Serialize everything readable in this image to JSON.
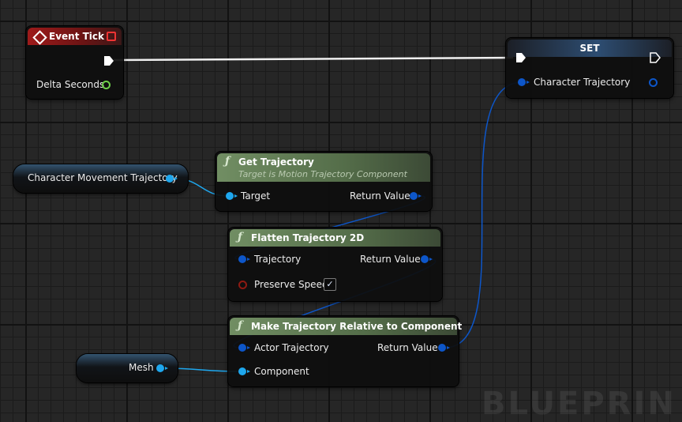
{
  "watermark": "BLUEPRIN",
  "event_tick": {
    "title": "Event Tick",
    "delta_seconds": "Delta Seconds"
  },
  "set_node": {
    "title": "SET",
    "pin": "Character Trajectory"
  },
  "char_move_var": {
    "label": "Character Movement Trajectory"
  },
  "get_trajectory": {
    "title": "Get Trajectory",
    "subtitle": "Target is Motion Trajectory Component",
    "target": "Target",
    "return_value": "Return Value"
  },
  "flatten": {
    "title": "Flatten Trajectory 2D",
    "trajectory": "Trajectory",
    "preserve_speed": "Preserve Speed",
    "preserve_speed_checked": true,
    "return_value": "Return Value"
  },
  "make_relative": {
    "title": "Make Trajectory Relative to Component",
    "actor_trajectory": "Actor Trajectory",
    "component": "Component",
    "return_value": "Return Value"
  },
  "mesh_var": {
    "label": "Mesh"
  },
  "colors": {
    "exec_wire": "#ffffff",
    "struct_pin": "#0d56c9",
    "object_pin": "#1ea7ee",
    "bool_pin": "#8e1a12",
    "float_pin": "#6fd04a",
    "event_header": "#9e1a1a",
    "function_header": "#718e63"
  }
}
